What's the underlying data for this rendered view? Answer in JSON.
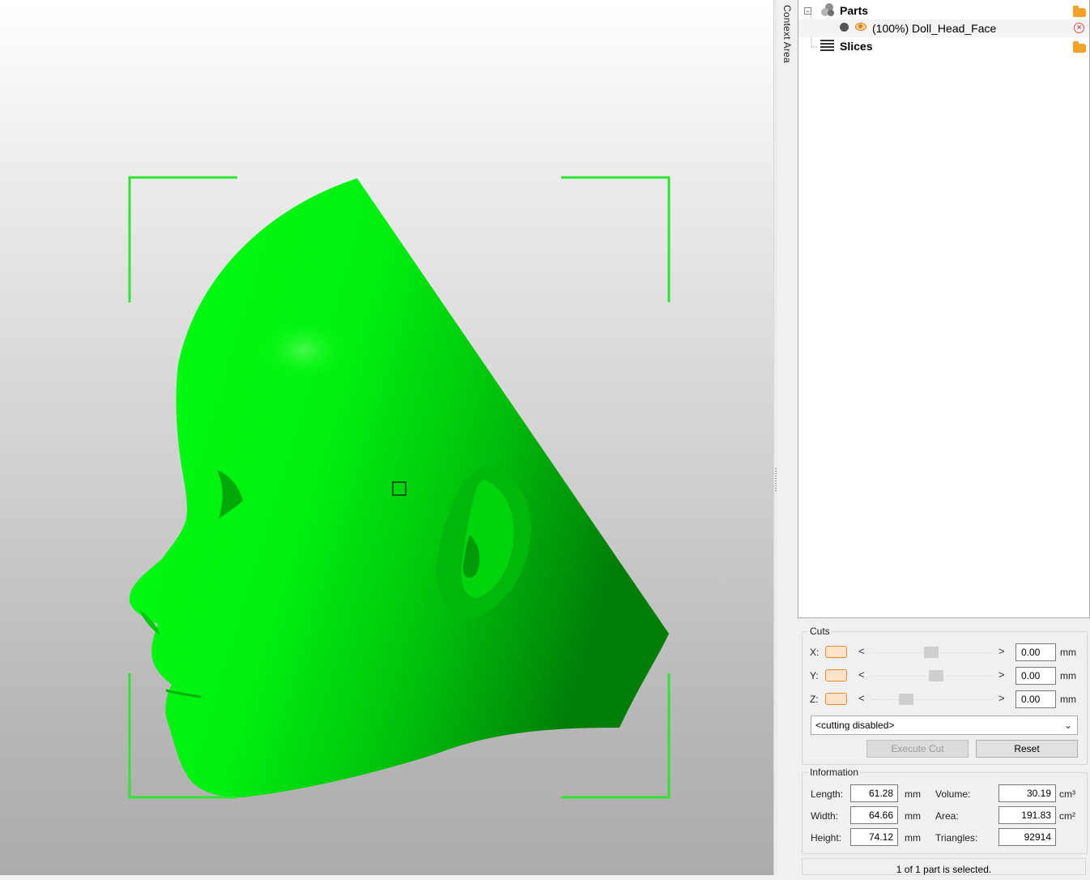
{
  "context_tab_label": "Context Area",
  "tree": {
    "parts_label": "Parts",
    "part_item_label": "(100%) Doll_Head_Face",
    "slices_label": "Slices",
    "expander_symbol": "−"
  },
  "cuts": {
    "title": "Cuts",
    "rows": [
      {
        "axis": "X:",
        "value": "0.00",
        "unit": "mm",
        "position": 0.49
      },
      {
        "axis": "Y:",
        "value": "0.00",
        "unit": "mm",
        "position": 0.54
      },
      {
        "axis": "Z:",
        "value": "0.00",
        "unit": "mm",
        "position": 0.26
      }
    ],
    "mode_selected": "<cutting disabled>",
    "execute_label": "Execute Cut",
    "reset_label": "Reset"
  },
  "information": {
    "title": "Information",
    "length_label": "Length:",
    "length_value": "61.28",
    "length_unit": "mm",
    "width_label": "Width:",
    "width_value": "64.66",
    "width_unit": "mm",
    "height_label": "Height:",
    "height_value": "74.12",
    "height_unit": "mm",
    "volume_label": "Volume:",
    "volume_value": "30.19",
    "volume_unit": "cm³",
    "area_label": "Area:",
    "area_value": "191.83",
    "area_unit": "cm²",
    "triangles_label": "Triangles:",
    "triangles_value": "92914"
  },
  "status": "1 of 1 part is selected.",
  "colors": {
    "model_green": "#00ff00",
    "model_shadow": "#008a00",
    "selection_bracket": "#2ee62e",
    "accent_orange": "#e68a2e"
  }
}
